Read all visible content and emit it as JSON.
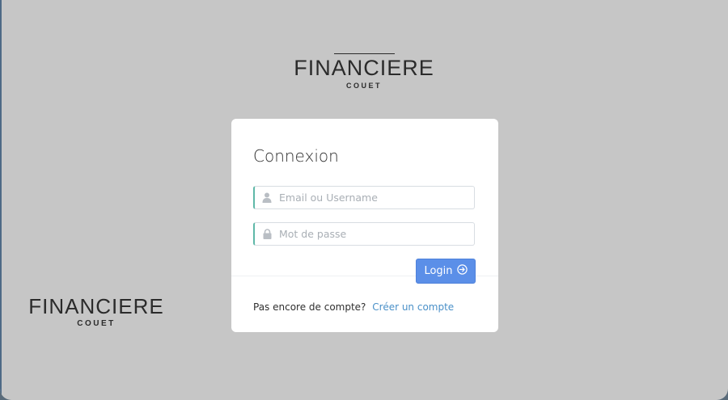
{
  "brand": {
    "name": "FINANCIERE",
    "sub": "COUET"
  },
  "login": {
    "title": "Connexion",
    "email_placeholder": "Email ou Username",
    "password_placeholder": "Mot de passe",
    "login_label": "Login",
    "signup_prompt": "Pas encore de compte?",
    "signup_link": "Créer un compte"
  },
  "icons": {
    "email": "user-icon",
    "password": "lock-icon",
    "login": "arrow-circle-right-icon"
  },
  "colors": {
    "background": "#c6c6c6",
    "card": "#ffffff",
    "accent_border": "#5fb8a8",
    "button": "#5b8fe8",
    "link": "#4a90c8"
  }
}
